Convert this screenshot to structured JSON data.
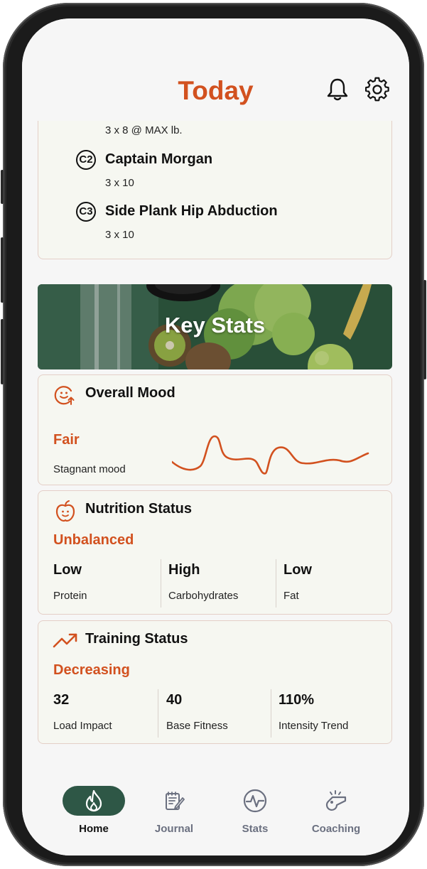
{
  "header": {
    "title": "Today",
    "bell_icon": "bell-icon",
    "settings_icon": "gear-icon"
  },
  "workout": {
    "prev_detail": "3 x 8 @ MAX lb.",
    "exercises": [
      {
        "num": "C2",
        "name": "Captain Morgan",
        "detail": "3 x 10"
      },
      {
        "num": "C3",
        "name": "Side Plank Hip Abduction",
        "detail": "3 x 10"
      }
    ]
  },
  "key_stats": {
    "title": "Key Stats"
  },
  "mood": {
    "title": "Overall Mood",
    "icon": "smiley-up-icon",
    "status": "Fair",
    "sub": "Stagnant mood",
    "trend_color": "#d2511f"
  },
  "nutrition": {
    "title": "Nutrition Status",
    "icon": "apple-icon",
    "status": "Unbalanced",
    "metrics": [
      {
        "value": "Low",
        "label": "Protein"
      },
      {
        "value": "High",
        "label": "Carbohydrates"
      },
      {
        "value": "Low",
        "label": "Fat"
      }
    ]
  },
  "training": {
    "title": "Training Status",
    "icon": "trending-up-icon",
    "status": "Decreasing",
    "metrics": [
      {
        "value": "32",
        "label": "Load Impact"
      },
      {
        "value": "40",
        "label": "Base Fitness"
      },
      {
        "value": "110%",
        "label": "Intensity Trend"
      }
    ]
  },
  "nav": {
    "items": [
      {
        "label": "Home",
        "icon": "flame-icon",
        "active": true
      },
      {
        "label": "Journal",
        "icon": "journal-icon",
        "active": false
      },
      {
        "label": "Stats",
        "icon": "heartbeat-icon",
        "active": false
      },
      {
        "label": "Coaching",
        "icon": "whistle-icon",
        "active": false
      }
    ]
  },
  "colors": {
    "accent": "#d2511f",
    "nav_active": "#2e5746",
    "card_bg": "#f6f7f1",
    "card_border": "#e4cfc7"
  }
}
